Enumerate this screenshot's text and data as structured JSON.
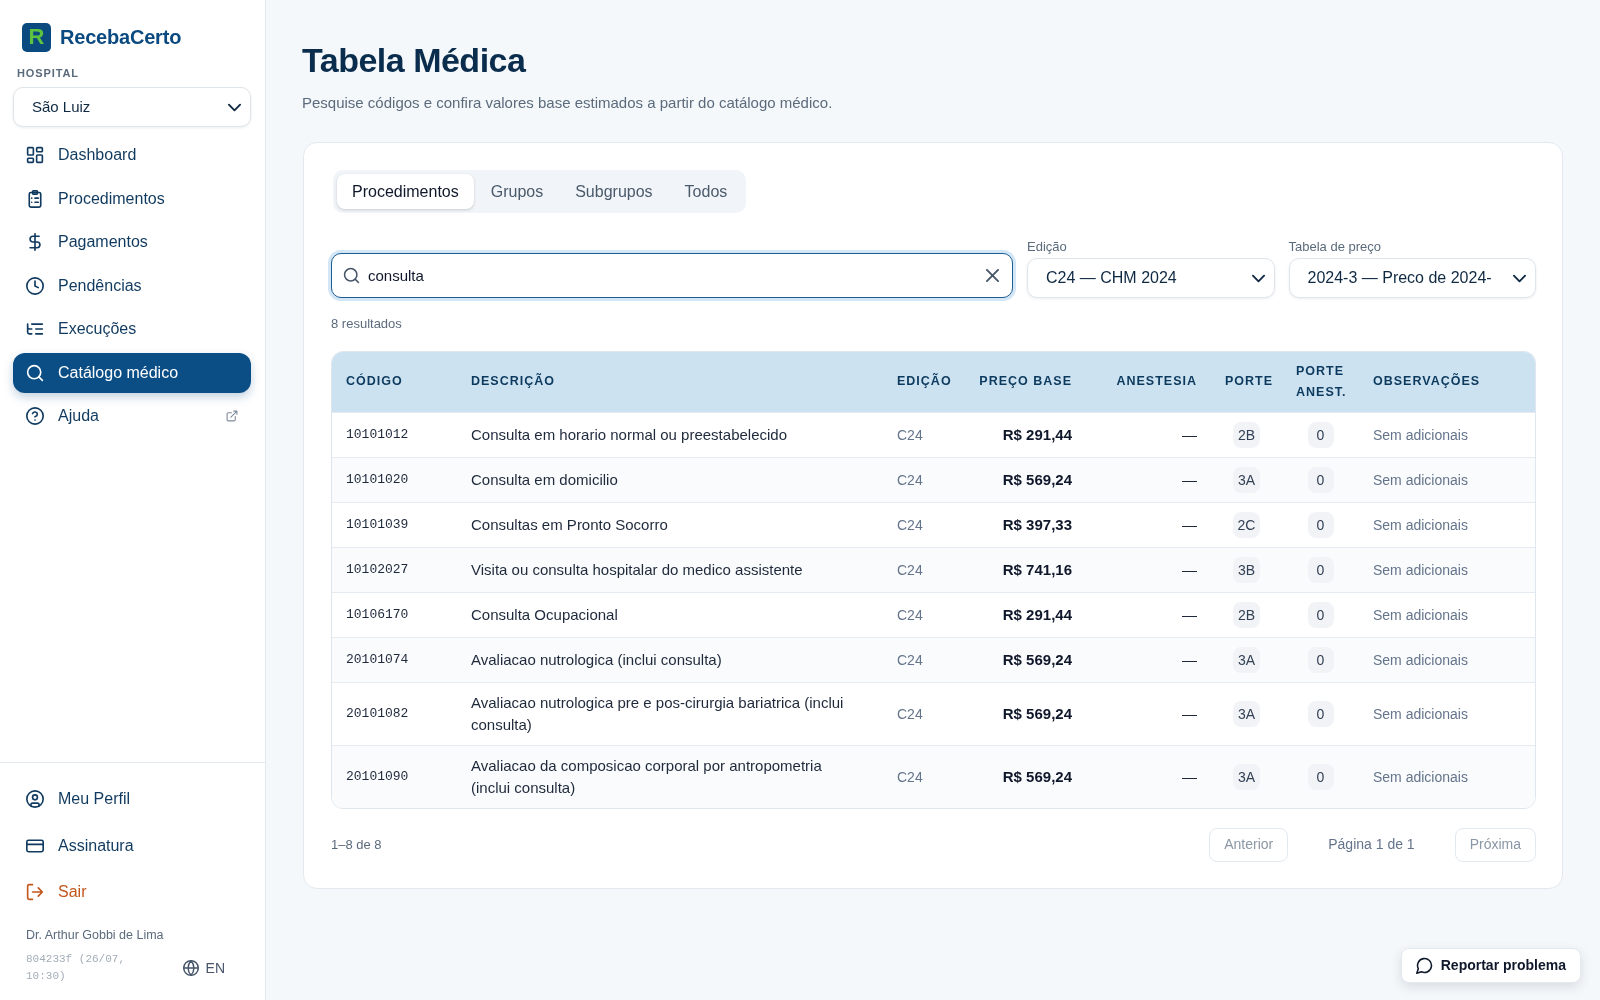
{
  "sidebar": {
    "brand": {
      "mark": "R",
      "name": "RecebaCerto"
    },
    "hospital": {
      "label": "HOSPITAL",
      "value": "São Luiz"
    },
    "nav": [
      {
        "label": "Dashboard",
        "selected": false,
        "external": false
      },
      {
        "label": "Procedimentos",
        "selected": false,
        "external": false
      },
      {
        "label": "Pagamentos",
        "selected": false,
        "external": false
      },
      {
        "label": "Pendências",
        "selected": false,
        "external": false
      },
      {
        "label": "Execuções",
        "selected": false,
        "external": false
      },
      {
        "label": "Catálogo médico",
        "selected": true,
        "external": false
      },
      {
        "label": "Ajuda",
        "selected": false,
        "external": true
      }
    ],
    "account": [
      {
        "label": "Meu Perfil",
        "kind": "default"
      },
      {
        "label": "Assinatura",
        "kind": "default"
      },
      {
        "label": "Sair",
        "kind": "danger"
      }
    ],
    "user_name": "Dr. Arthur Gobbi de Lima",
    "build": "804233f (26/07, 10:30)",
    "language": "EN"
  },
  "header": {
    "title": "Tabela Médica",
    "subtitle": "Pesquise códigos e confira valores base estimados a partir do catálogo médico."
  },
  "tabs": [
    {
      "label": "Procedimentos",
      "selected": true
    },
    {
      "label": "Grupos",
      "selected": false
    },
    {
      "label": "Subgrupos",
      "selected": false
    },
    {
      "label": "Todos",
      "selected": false
    }
  ],
  "search": {
    "value": "consulta",
    "focused": true
  },
  "filters": [
    {
      "label": "Edição",
      "value": "C24 — CHM 2024"
    },
    {
      "label": "Tabela de preço",
      "value": "2024-3 — Preco de 2024-"
    }
  ],
  "result_count": "8 resultados",
  "table": {
    "columns": [
      "CÓDIGO",
      "DESCRIÇÃO",
      "EDIÇÃO",
      "PREÇO BASE",
      "ANESTESIA",
      "PORTE",
      "PORTE ANEST.",
      "OBSERVAÇÕES"
    ],
    "rows": [
      {
        "code": "10101012",
        "description": "Consulta em horario normal ou preestabelecido",
        "edition": "C24",
        "base_price": "R$ 291,44",
        "anesthesia": "—",
        "porte": "2B",
        "porte_anesthesia": "0",
        "notes": "Sem adicionais"
      },
      {
        "code": "10101020",
        "description": "Consulta em domicilio",
        "edition": "C24",
        "base_price": "R$ 569,24",
        "anesthesia": "—",
        "porte": "3A",
        "porte_anesthesia": "0",
        "notes": "Sem adicionais"
      },
      {
        "code": "10101039",
        "description": "Consultas em Pronto Socorro",
        "edition": "C24",
        "base_price": "R$ 397,33",
        "anesthesia": "—",
        "porte": "2C",
        "porte_anesthesia": "0",
        "notes": "Sem adicionais"
      },
      {
        "code": "10102027",
        "description": "Visita ou consulta hospitalar do medico assistente",
        "edition": "C24",
        "base_price": "R$ 741,16",
        "anesthesia": "—",
        "porte": "3B",
        "porte_anesthesia": "0",
        "notes": "Sem adicionais"
      },
      {
        "code": "10106170",
        "description": "Consulta Ocupacional",
        "edition": "C24",
        "base_price": "R$ 291,44",
        "anesthesia": "—",
        "porte": "2B",
        "porte_anesthesia": "0",
        "notes": "Sem adicionais"
      },
      {
        "code": "20101074",
        "description": "Avaliacao nutrologica (inclui consulta)",
        "edition": "C24",
        "base_price": "R$ 569,24",
        "anesthesia": "—",
        "porte": "3A",
        "porte_anesthesia": "0",
        "notes": "Sem adicionais"
      },
      {
        "code": "20101082",
        "description": "Avaliacao nutrologica pre e pos-cirurgia bariatrica (inclui consulta)",
        "edition": "C24",
        "base_price": "R$ 569,24",
        "anesthesia": "—",
        "porte": "3A",
        "porte_anesthesia": "0",
        "notes": "Sem adicionais"
      },
      {
        "code": "20101090",
        "description": "Avaliacao da composicao corporal por antropometria (inclui consulta)",
        "edition": "C24",
        "base_price": "R$ 569,24",
        "anesthesia": "—",
        "porte": "3A",
        "porte_anesthesia": "0",
        "notes": "Sem adicionais"
      }
    ]
  },
  "pagination": {
    "range": "1–8 de 8",
    "previous": {
      "label": "Anterior",
      "disabled": true
    },
    "page": "Página 1 de 1",
    "next": {
      "label": "Próxima",
      "disabled": true
    }
  },
  "report_button": "Reportar problema"
}
